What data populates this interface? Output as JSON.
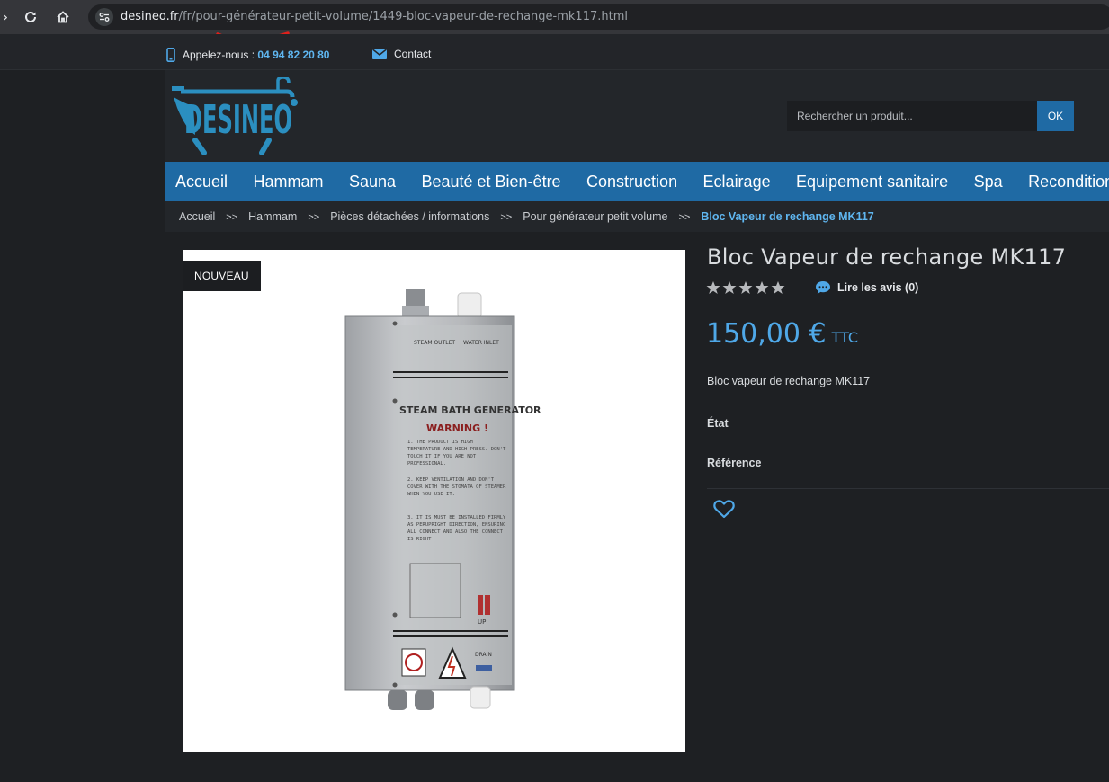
{
  "browser": {
    "url_host": "desineo.fr",
    "url_path": "/fr/pour-générateur-petit-volume/1449-bloc-vapeur-de-rechange-mk117.html"
  },
  "topbar": {
    "phone_label": "Appelez-nous :",
    "phone_number": "04 94 82 20 80",
    "contact_label": "Contact"
  },
  "search": {
    "placeholder": "Rechercher un produit...",
    "button": "OK"
  },
  "nav": {
    "items": [
      "Accueil",
      "Hammam",
      "Sauna",
      "Beauté et Bien-être",
      "Construction",
      "Eclairage",
      "Equipement sanitaire",
      "Spa",
      "Reconditionné"
    ]
  },
  "breadcrumb": {
    "items": [
      "Accueil",
      "Hammam",
      "Pièces détachées / informations",
      "Pour générateur petit volume"
    ],
    "separator": ">>",
    "current": "Bloc Vapeur de rechange MK117"
  },
  "product": {
    "badge": "NOUVEAU",
    "title": "Bloc Vapeur de rechange MK117",
    "rating": 5,
    "reviews_label": "Lire les avis (0)",
    "price": "150,00 €",
    "price_suffix": "TTC",
    "description": "Bloc vapeur de rechange MK117",
    "attr_condition": "État",
    "attr_reference": "Référence",
    "image_texts": {
      "steam_outlet": "STEAM OUTLET",
      "water_inlet": "WATER INLET",
      "heading": "STEAM BATH GENERATOR",
      "warning": "WARNING !",
      "rule1": "1. THE PRODUCT IS HIGH TEMPERATURE AND HIGH PRESS. DON'T TOUCH IT IF YOU ARE NOT PROFESSIONAL.",
      "rule2": "2. KEEP VENTILATION AND DON'T COVER WITH THE STOMATA OF STEAMER WHEN YOU USE IT.",
      "rule3": "3. IT IS MUST BE INSTALLED FIRMLY AS PERUPRIGHT DIRECTION, ENSURING ALL CONNECT AND ALSO THE CONNECT IS RIGHT",
      "up": "UP",
      "drain": "DRAIN"
    }
  },
  "colors": {
    "brand_blue": "#1f6aa4",
    "accent_blue": "#4fa8e8",
    "logo_blue": "#2b8fc0",
    "annotation_red": "#e0201b"
  }
}
